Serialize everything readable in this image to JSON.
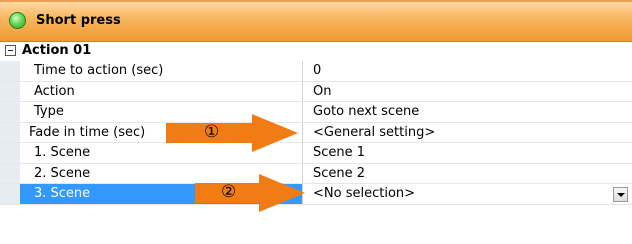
{
  "header": {
    "title": "Short press"
  },
  "group": {
    "label": "Action 01"
  },
  "rows": [
    {
      "name": "Time to action (sec)",
      "value": "0"
    },
    {
      "name": "Action",
      "value": "On"
    },
    {
      "name": "Type",
      "value": "Goto next scene"
    },
    {
      "name": "Fade in time (sec)",
      "value": "<General setting>"
    },
    {
      "name": "1. Scene",
      "value": "Scene 1"
    },
    {
      "name": "2. Scene",
      "value": "Scene 2"
    },
    {
      "name": "3. Scene",
      "value": "<No selection>"
    }
  ],
  "annotations": {
    "arrow1": "①",
    "arrow2": "②"
  },
  "colors": {
    "header": "#f7b45a",
    "selection": "#3399ff",
    "arrow": "#f27c14"
  }
}
